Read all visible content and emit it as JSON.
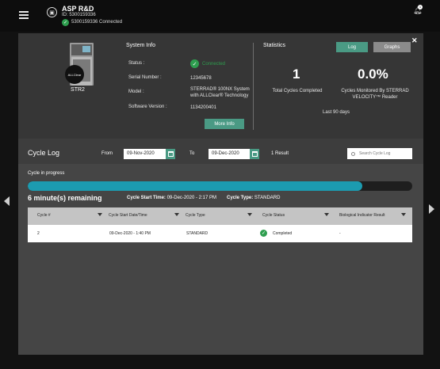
{
  "header": {
    "department_name": "ASP R&D",
    "department_id": "ID: 5300159336",
    "connection_status": "5300159336 Connected",
    "notification_count": "1"
  },
  "system_info": {
    "title": "System Info",
    "device_name": "STR2",
    "status_label": "Status :",
    "status_value": "Connected",
    "serial_label": "Serial Number :",
    "serial_value": "12345678",
    "model_label": "Model :",
    "model_line1": "STERRAD® 100NX System",
    "model_line2": "with ALLClear® Technology",
    "software_label": "Software Version :",
    "software_value": "1134200401",
    "more_info_label": "More Info"
  },
  "statistics": {
    "title": "Statistics",
    "log_label": "Log",
    "graphs_label": "Graphs",
    "total_cycles_value": "1",
    "total_cycles_label": "Total Cycles Completed",
    "velocity_value": "0.0%",
    "velocity_label_line1": "Cycles Monitored By STERRAD",
    "velocity_label_line2": "VELOCITY™ Reader",
    "period": "Last 90 days"
  },
  "cycle_log": {
    "title": "Cycle Log",
    "from_label": "From",
    "from_value": "09-Nov-2020",
    "to_label": "To",
    "to_value": "09-Dec-2020",
    "result_count": "1 Result",
    "search_placeholder": "Search Cycle Log"
  },
  "in_progress": {
    "label": "Cycle in progress",
    "progress_fraction": 0.87,
    "remaining": "6 minute(s) remaining",
    "start_time_label": "Cycle Start Time:",
    "start_time_value": "09-Dec-2020 - 2:17 PM",
    "cycle_type_label": "Cycle Type:",
    "cycle_type_value": "STANDARD"
  },
  "table": {
    "columns": [
      "Cycle #",
      "Cycle Start Date/Time",
      "Cycle Type",
      "Cycle Status",
      "Biological Indicator Result"
    ],
    "rows": [
      {
        "cycle": "2",
        "start": "09-Dec-2020 - 1:40 PM",
        "type": "STANDARD",
        "status": "Completed",
        "bi_result": "-"
      }
    ]
  },
  "colors": {
    "accent": "#4a9a84",
    "progress": "#1c9bb0",
    "success": "#2e9e4f"
  }
}
